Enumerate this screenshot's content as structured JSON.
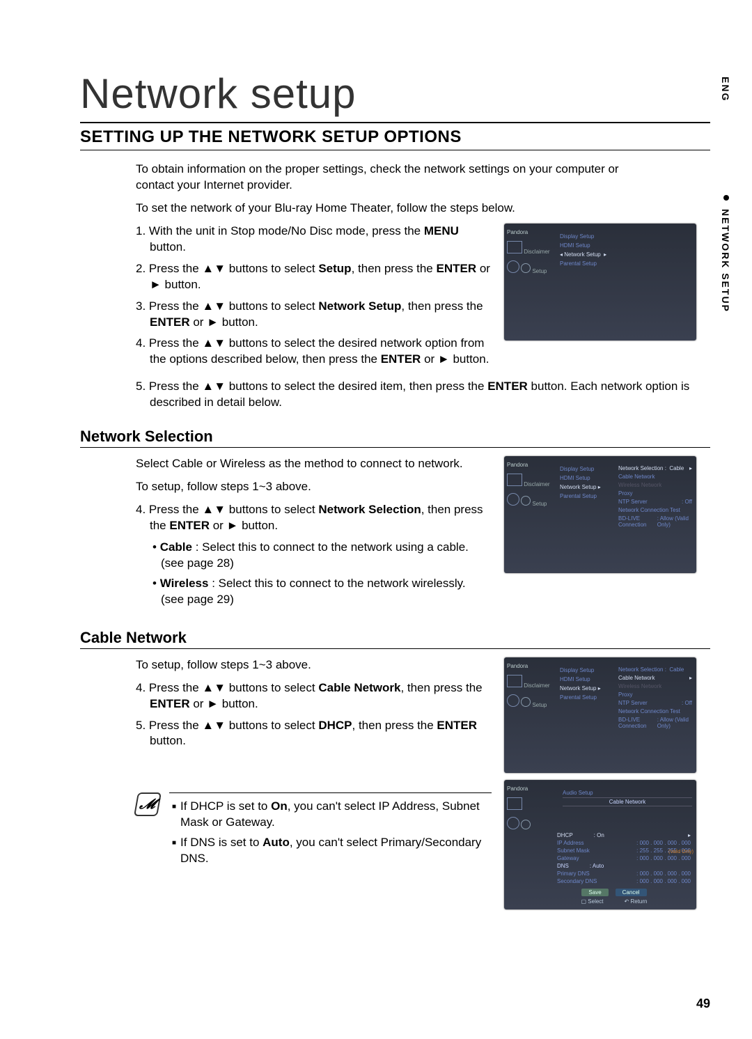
{
  "side": {
    "lang": "ENG",
    "section": "NETWORK SETUP"
  },
  "title": "Network setup",
  "section_heading": "SETTING UP THE NETWORK SETUP OPTIONS",
  "intro1": "To obtain information on the proper settings, check the network settings on your computer or contact your Internet provider.",
  "intro2": "To set the network of your Blu-ray Home Theater, follow the steps below.",
  "steps_main": {
    "s1a": "1. With the unit in Stop mode/No Disc mode, press the ",
    "s1b": "MENU",
    "s1c": " button.",
    "s2a": "2. Press the ▲▼ buttons to select ",
    "s2b": "Setup",
    "s2c": ", then press the ",
    "s2d": "ENTER",
    "s2e": " or ► button.",
    "s3a": "3. Press the ▲▼ buttons to select ",
    "s3b": "Network Setup",
    "s3c": ", then press the ",
    "s3d": "ENTER",
    "s3e": " or ► button.",
    "s4a": "4. Press the ▲▼ buttons to select the desired network option from the options described below, then press the ",
    "s4b": "ENTER",
    "s4c": " or ► button.",
    "s5a": "5. Press the ▲▼ buttons to select the desired item, then press the ",
    "s5b": "ENTER",
    "s5c": " button. Each network option is described in detail below."
  },
  "sub1_h": "Network Selection",
  "sub1_p1": "Select Cable or Wireless as the method to connect to network.",
  "sub1_p2": "To setup, follow steps 1~3 above.",
  "sub1_s4a": "4. Press the ▲▼ buttons to select ",
  "sub1_s4b": "Network Selection",
  "sub1_s4c": ", then press the ",
  "sub1_s4d": "ENTER",
  "sub1_s4e": " or ► button.",
  "sub1_b1a": "Cable",
  "sub1_b1b": " : Select this to connect to the network using a cable. (see page 28)",
  "sub1_b2a": "Wireless",
  "sub1_b2b": " : Select this to connect to the network wirelessly. (see page 29)",
  "sub2_h": "Cable Network",
  "sub2_p1": "To setup, follow steps 1~3 above.",
  "sub2_s4a": "4. Press the ▲▼ buttons to select ",
  "sub2_s4b": "Cable Network",
  "sub2_s4c": ", then press the ",
  "sub2_s4d": "ENTER",
  "sub2_s4e": " or ► button.",
  "sub2_s5a": "5. Press the ▲▼ buttons to select ",
  "sub2_s5b": "DHCP",
  "sub2_s5c": ", then press the ",
  "sub2_s5d": "ENTER",
  "sub2_s5e": " button.",
  "note1a": "If DHCP is set to ",
  "note1b": "On",
  "note1c": ", you can't select IP Address, Subnet Mask or Gateway.",
  "note2a": "If DNS is set to ",
  "note2b": "Auto",
  "note2c": ", you can't select Primary/Secondary DNS.",
  "fig_common": {
    "brand": "Pandora",
    "disclaimer": "Disclaimer",
    "setup": "Setup",
    "menu": {
      "display": "Display Setup",
      "hdmi": "HDMI Setup",
      "network": "Network Setup",
      "parental": "Parental Setup",
      "audio": "Audio Setup"
    }
  },
  "fig2": {
    "ns_label": "Network Selection :",
    "ns_value": "Cable",
    "items": {
      "cable": "Cable Network",
      "wireless": "Wireless Network",
      "proxy": "Proxy",
      "ntp_l": "NTP Server",
      "ntp_v": ": Off",
      "test": "Network Connection Test",
      "bd_l": "BD-LIVE Connection",
      "bd_v": ": Allow (Valid Only)"
    }
  },
  "fig3": {
    "ns_label": "Network Selection :",
    "ns_value": "Cable",
    "items": {
      "cable": "Cable Network",
      "wireless": "Wireless Network",
      "proxy": "Proxy",
      "ntp_l": "NTP Server",
      "ntp_v": ": Off",
      "test": "Network Connection Test",
      "bd_l": "BD-LIVE Connection",
      "bd_v": ": Allow (Valid Only)"
    }
  },
  "fig4": {
    "header": "Cable Network",
    "rows": {
      "dhcp_l": "DHCP",
      "dhcp_v": ": On",
      "ip_l": "IP Address",
      "ip_v": ": 000 . 000 . 000 . 000",
      "sm_l": "Subnet Mask",
      "sm_v": ": 255 . 255 . 255 . 000",
      "gw_l": "Gateway",
      "gw_v": ": 000 . 000 . 000 . 000",
      "dns_l": "DNS",
      "dns_v": ": Auto",
      "pd_l": "Primary DNS",
      "pd_v": ": 000 . 000 . 000 . 000",
      "sd_l": "Secondary DNS",
      "sd_v": ": 000 . 000 . 000 . 000"
    },
    "valid": "(Valid Only)",
    "save": "Save",
    "cancel": "Cancel",
    "select": "Select",
    "return": "Return"
  },
  "page_number": "49"
}
